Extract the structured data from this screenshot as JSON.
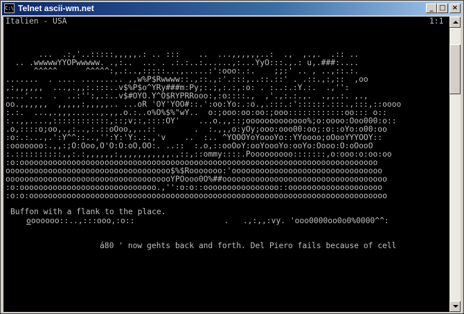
{
  "window": {
    "title": "Telnet ascii-wm.net",
    "sys_icon": "C:\\",
    "controls": {
      "minimize": "_",
      "maximize": "□",
      "close": "×"
    }
  },
  "console": {
    "header_left": "Italien - USA",
    "header_right": "1:1",
    "art_lines": [
      "",
      "       ...  .:,'..:::::,,,,,.: .. :::    ..  ...,,,,,,..:  .,  ,.,.  .:: ..",
      "  .. .wwwwwYYOPwwwww. .,:..  ... . .:.:..:......,:...YyO:::.,.: u,.###:....",
      "      ^^^^^      ^^^^^:,.:..,:::::...,.....:':ooo:.:.    ;;:' .. , ..,::.:.",
      ".......  . .... ......... ,,w%P$Rwwww::.,::.,:'.:::,..::.::' . .::.,:,::  ,oo",
      ",:,,,,,,  ...,.,,:.:::..v$%P$o^YRy###m:Py;:.;,:.:,:o: . :..:.:Y.:.  .,'':",
      "....'...  .  ..:'':,.:..v$#OYO.Y^O$RYPRRooo:,:o::::.,  ,'.,:.:.,.  .,,.:. ,.,",
      "oo.,,,,,,  ,,,,,:,,,,,.. ...oR 'OY'YOO#::.':oo:Yo:.:o.,.:::.:'::::::.:::.,:::,::oooo",
      ":.:.  ...,.,,,......,.,,.o.:..o%O%$%\"wY..  o:;ooo:oo:oo:;ooo::::::::::::oo::: o::",
      ":..,,....,::::::::::::,::;v;:,::::OY'    ...o.,,::;ooooooooooooo%;o:oooo:Ooo000:o::",
      ".o,::::o;oo,.,:..,:.::oOoo,,..::        .  :.,,,o:yOy;ooo:ooo00:oo;:o::oYo:o00:oo",
      ":o:.:...,.':Y^^::..,'':Y:'Y:.:.,'v    ..  :.. ^YOOOYoYoooYo::YYoooo;oOooYYYOOY::",
      ":ooooooo:.,,:;O:Ooo,O'O:O:oO,OO:. ..::  :.o,::ooOoY:ooYoooYo:ooYo:Oooo:O:oOooO",
      ":.::::::::::,,:.:,,,,,,:,,,,,,,,,,,.,::,::ommy::::.Pooooooooo:::::::,o:ooo:o:oo:oo",
      ":o:oooooooooooooooooooooooooooooooooooooooooooooooooooooooooooooooooooooooooooo",
      "ooooooooooooooooooooooooooooooooooo$%$Rooooooo:'oooooooooooooooooooooooooooooooo",
      "oooooooooooooooooooooooooooooooooooYPOooo0O%##ooooooooooooooooooooooooooooooooooo",
      ":o:ooooooooooooooooooooooooooooo.,'':o:o::oooooooooooooooo::oooooooooooooooooooo",
      ":o:o:oooooooooooooooooooooooooooooooooooooooooooooooooooooooooooooooooooooooooooo"
    ],
    "caption": "Buffon with a flank to the place.",
    "scroll_line_cursor": "o",
    "scroll_line_rest": "oooooo::..,:::ooo,:o::                   .   .,:,,:vy. 'ooo0000oo0o0%0000^^:",
    "ticker": "á80 ' now gehts back and forth. Del Piero fails because of cell"
  }
}
